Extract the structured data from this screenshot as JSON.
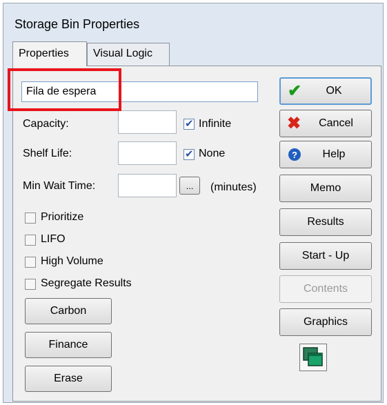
{
  "window": {
    "title": "Storage Bin Properties"
  },
  "tabs": [
    {
      "label": "Properties",
      "active": true
    },
    {
      "label": "Visual Logic",
      "active": false
    }
  ],
  "name_field": {
    "value": "Fila de espera"
  },
  "capacity": {
    "label": "Capacity:",
    "value": "",
    "checkbox_label": "Infinite",
    "checked": true
  },
  "shelf_life": {
    "label": "Shelf Life:",
    "value": "",
    "checkbox_label": "None",
    "checked": true
  },
  "min_wait": {
    "label": "Min Wait Time:",
    "value": "",
    "browse_label": "...",
    "units": "(minutes)"
  },
  "options": [
    {
      "label": "Prioritize",
      "checked": false
    },
    {
      "label": "LIFO",
      "checked": false
    },
    {
      "label": "High Volume",
      "checked": false
    },
    {
      "label": "Segregate Results",
      "checked": false
    }
  ],
  "left_buttons": [
    "Carbon",
    "Finance",
    "Erase"
  ],
  "right_buttons": {
    "ok": "OK",
    "cancel": "Cancel",
    "help": "Help",
    "memo": "Memo",
    "results": "Results",
    "startup": "Start - Up",
    "contents": "Contents",
    "graphics": "Graphics"
  },
  "icons": {
    "ok": "checkmark-icon",
    "cancel": "x-cross-icon",
    "help": "help-question-icon",
    "graphic": "stacked-windows-icon"
  },
  "colors": {
    "highlight_box": "#e8141b",
    "ok_check": "#1a9a1a",
    "cancel_x": "#d8241a",
    "help_blue": "#1f5fbf",
    "graphic_green": "#1aa36a"
  }
}
